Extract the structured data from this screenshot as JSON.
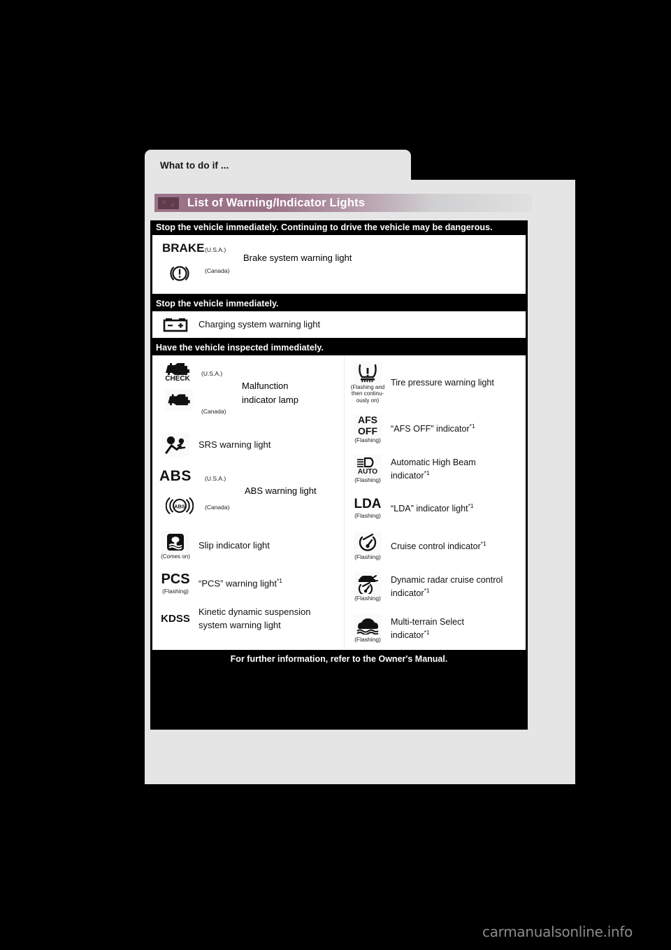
{
  "tab": {
    "label": "What to do if ..."
  },
  "section": {
    "title": "List of Warning/Indicator Lights",
    "mark": "textured-square-icon"
  },
  "headers": {
    "stop_immediately_dangerous": "Stop the vehicle immediately. Continuing to drive the vehicle may be dangerous.",
    "stop_immediately": "Stop the vehicle immediately.",
    "have_inspected": "Have the vehicle inspected immediately."
  },
  "footer": {
    "text": "For further information, refer to the Owner's Manual."
  },
  "brake_row": {
    "usa_glyph": "BRAKE",
    "usa_note": "(U.S.A.)",
    "canada_glyph": "brake-circle-exclamation-icon",
    "canada_note": "(Canada)",
    "name": "Brake system warning light"
  },
  "charging_row": {
    "glyph": "battery-icon",
    "name": "Charging system warning light"
  },
  "left_column": [
    {
      "id": "malfunction-indicator-lamp",
      "usa_glyph": "check-engine-check-icon",
      "usa_note": "(U.S.A.)",
      "canada_glyph": "check-engine-icon",
      "canada_note": "(Canada)",
      "name_line1": "Malfunction",
      "name_line2": "indicator lamp"
    },
    {
      "id": "srs-warning-light",
      "glyph": "srs-airbag-icon",
      "note": "",
      "name": "SRS warning light"
    },
    {
      "id": "abs-warning-light",
      "usa_glyph": "ABS",
      "usa_note": "(U.S.A.)",
      "canada_glyph": "abs-circle-icon",
      "canada_note": "(Canada)",
      "name": "ABS warning light"
    },
    {
      "id": "slip-indicator-light",
      "glyph": "slip-skid-icon",
      "note": "(Comes on)",
      "name": "Slip indicator light"
    },
    {
      "id": "pcs-warning-light",
      "glyph": "PCS",
      "note": "(Flashing)",
      "name": "“PCS” warning light",
      "footnote": "*1"
    },
    {
      "id": "kdss-warning-light",
      "glyph": "KDSS",
      "note": "",
      "name_line1": "Kinetic dynamic suspension",
      "name_line2": "system warning light"
    }
  ],
  "right_column": [
    {
      "id": "tire-pressure-warning-light",
      "glyph": "tire-pressure-icon",
      "note_line1": "(Flashing and",
      "note_line2": "then continu-",
      "note_line3": "ously on)",
      "name": "Tire pressure warning light"
    },
    {
      "id": "afs-off-indicator",
      "glyph_line1": "AFS",
      "glyph_line2": "OFF",
      "note": "(Flashing)",
      "name": "“AFS OFF” indicator",
      "footnote": "*1"
    },
    {
      "id": "automatic-high-beam-indicator",
      "glyph": "auto-high-beam-icon",
      "glyph_label": "AUTO",
      "note": "(Flashing)",
      "name_line1": "Automatic High Beam",
      "name_line2": "indicator",
      "footnote": "*1"
    },
    {
      "id": "lda-indicator-light",
      "glyph": "LDA",
      "note": "(Flashing)",
      "name": "“LDA” indicator light",
      "footnote": "*1"
    },
    {
      "id": "cruise-control-indicator",
      "glyph": "cruise-control-icon",
      "note": "(Flashing)",
      "name": "Cruise control indicator",
      "footnote": "*1"
    },
    {
      "id": "dynamic-radar-cruise-control-indicator",
      "glyph": "dynamic-radar-cruise-icon",
      "note": "(Flashing)",
      "name_line1": "Dynamic radar cruise control",
      "name_line2": "indicator",
      "footnote": "*1"
    },
    {
      "id": "multi-terrain-select-indicator",
      "glyph": "multi-terrain-icon",
      "note": "(Flashing)",
      "name_line1": "Multi-terrain Select",
      "name_line2": "indicator",
      "footnote": "*1"
    }
  ],
  "watermark": {
    "text": "carmanualsonline.info"
  },
  "colors": {
    "page_bg": "#e5e5e5",
    "table_bg": "#000000",
    "panel_bg": "#ffffff",
    "banner_accent": "#9b7389",
    "banner_fade": "#e0e0e1",
    "watermark": "#8c8c8c"
  }
}
